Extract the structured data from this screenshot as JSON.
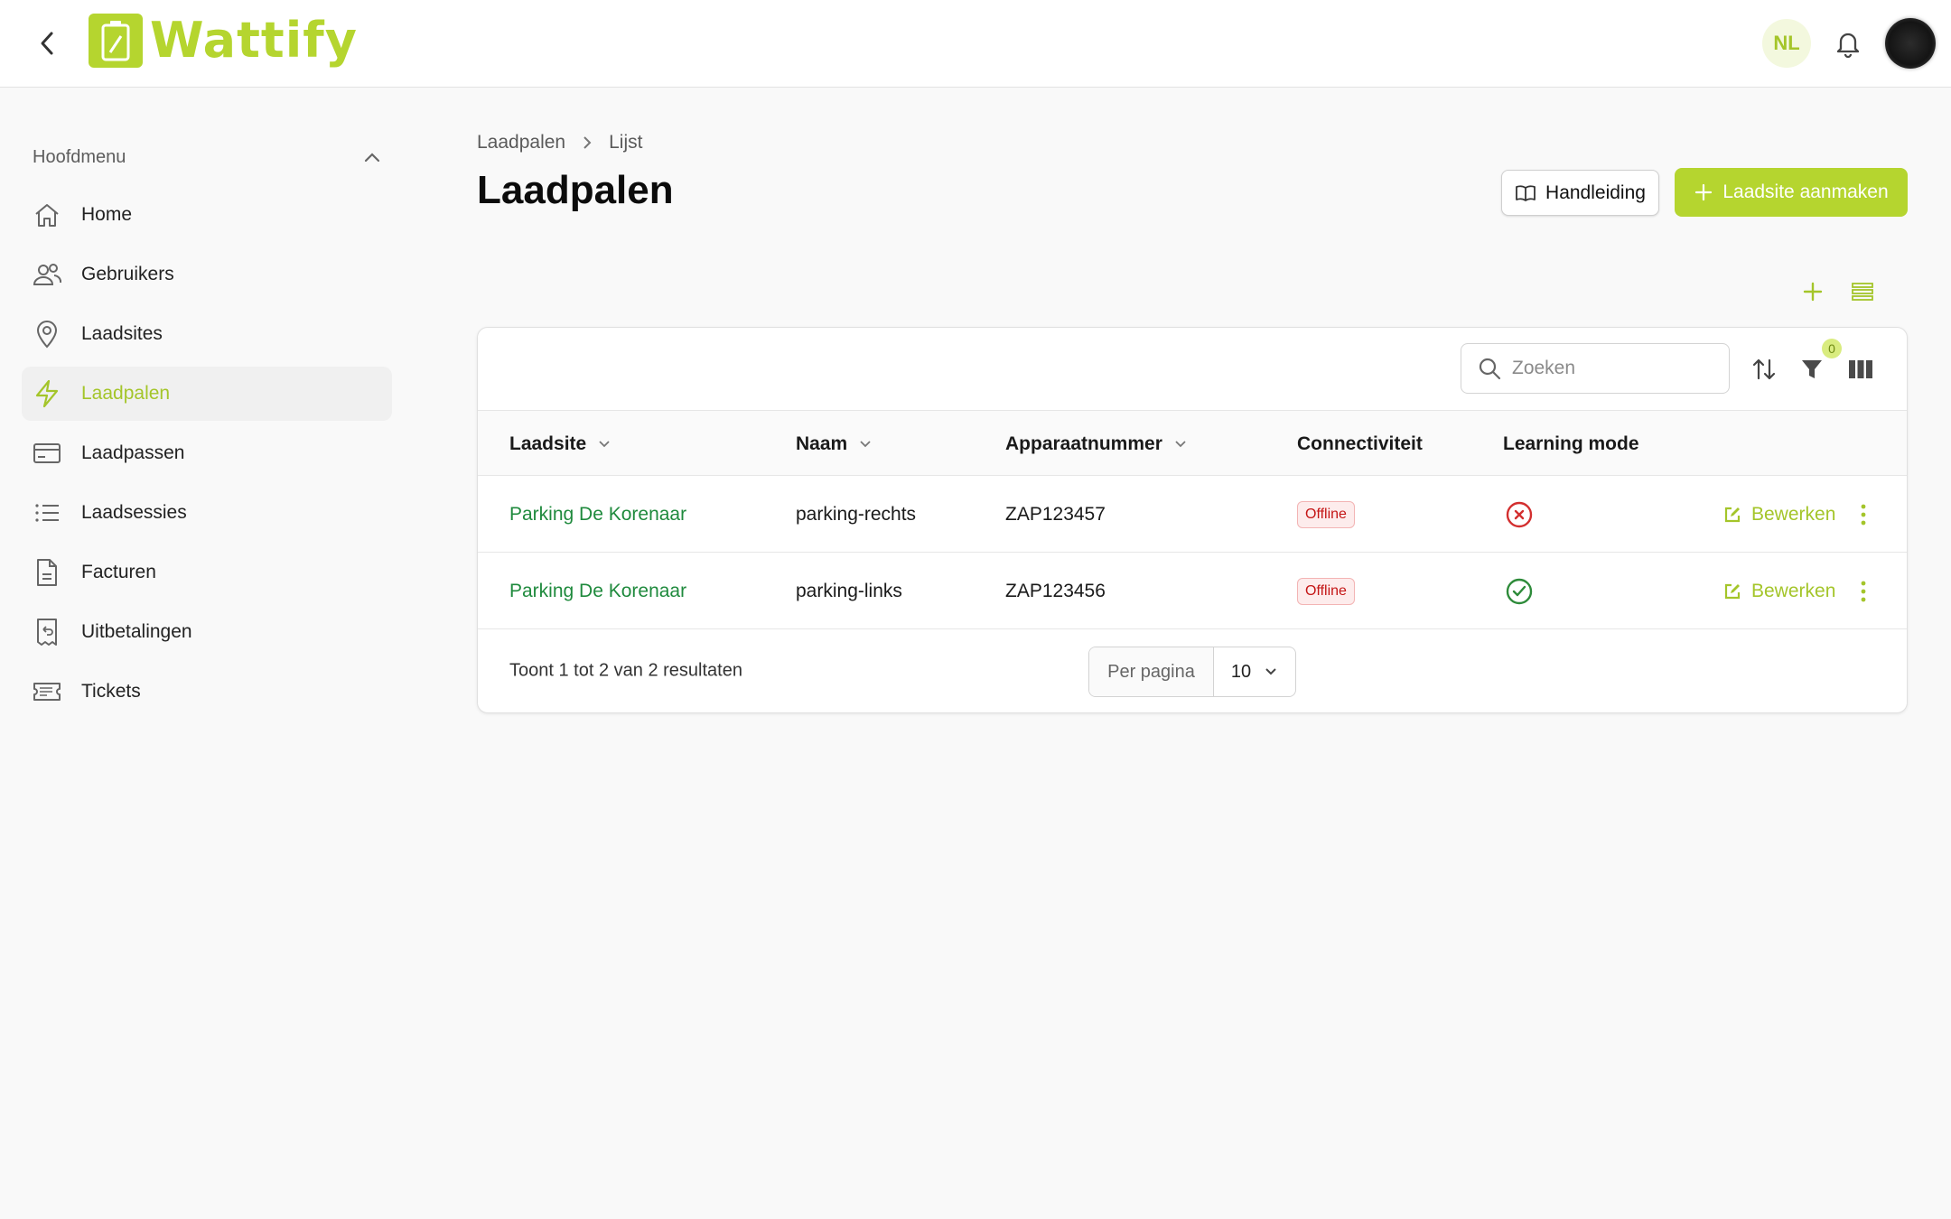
{
  "app": {
    "name": "Wattify",
    "brand_color": "#b5d52f"
  },
  "header": {
    "language": "NL",
    "icons": [
      "back-icon",
      "bell-icon",
      "avatar"
    ]
  },
  "sidebar": {
    "title": "Hoofdmenu",
    "items": [
      {
        "label": "Home",
        "icon": "home-icon"
      },
      {
        "label": "Gebruikers",
        "icon": "users-icon"
      },
      {
        "label": "Laadsites",
        "icon": "map-pin-icon"
      },
      {
        "label": "Laadpalen",
        "icon": "lightning-icon",
        "active": true
      },
      {
        "label": "Laadpassen",
        "icon": "card-icon"
      },
      {
        "label": "Laadsessies",
        "icon": "list-icon"
      },
      {
        "label": "Facturen",
        "icon": "document-icon"
      },
      {
        "label": "Uitbetalingen",
        "icon": "receipt-refund-icon"
      },
      {
        "label": "Tickets",
        "icon": "ticket-icon"
      }
    ]
  },
  "breadcrumb": {
    "items": [
      "Laadpalen",
      "Lijst"
    ]
  },
  "page": {
    "title": "Laadpalen",
    "manual_button": "Handleiding",
    "create_button": "Laadsite aanmaken"
  },
  "table": {
    "search_placeholder": "Zoeken",
    "filter_count": "0",
    "columns": [
      "Laadsite",
      "Naam",
      "Apparaatnummer",
      "Connectiviteit",
      "Learning mode"
    ],
    "rows": [
      {
        "laadsite": "Parking De Korenaar",
        "naam": "parking-rechts",
        "apparaatnummer": "ZAP123457",
        "connectiviteit": "Offline",
        "learning_mode": "off",
        "action": "Bewerken"
      },
      {
        "laadsite": "Parking De Korenaar",
        "naam": "parking-links",
        "apparaatnummer": "ZAP123456",
        "connectiviteit": "Offline",
        "learning_mode": "on",
        "action": "Bewerken"
      }
    ],
    "footer": {
      "summary": "Toont 1 tot 2 van 2 resultaten",
      "per_page_label": "Per pagina",
      "per_page_value": "10"
    }
  },
  "colors": {
    "accent": "#a4c52a",
    "link": "#1f8a3d",
    "error": "#d32f2f",
    "success": "#2e8b3a"
  }
}
